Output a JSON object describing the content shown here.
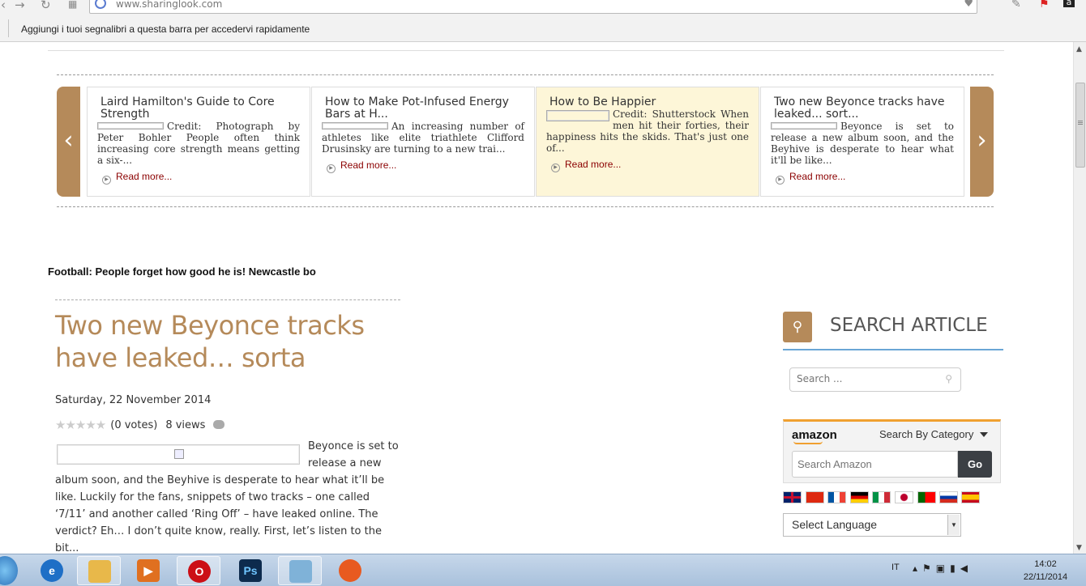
{
  "browser": {
    "url": "www.sharinglook.com",
    "bookmarks_hint": "Aggiungi i tuoi segnalibri a questa barra per accedervi rapidamente"
  },
  "carousel": {
    "prev_icon": "chevron-left-icon",
    "next_icon": "chevron-right-icon",
    "cards": [
      {
        "title": "Laird Hamilton's Guide to Core Strength",
        "excerpt": "Credit: Photograph by Peter Bohler People often think increasing core strength means getting a six-...",
        "read_more": "Read more..."
      },
      {
        "title": "How to Make Pot-Infused Energy Bars at H...",
        "excerpt": "An increasing number of athletes like elite triathlete Clifford Drusinsky are turning to a new trai...",
        "read_more": "Read more..."
      },
      {
        "title": "How to Be Happier",
        "excerpt": "Credit: Shutterstock When men hit their forties, their happiness hits the skids. That's just one of...",
        "read_more": "Read more..."
      },
      {
        "title": "Two new Beyonce tracks have leaked... sort...",
        "excerpt": "Beyonce is set to release a new album soon, and the Beyhive is desperate to hear what it'll be like...",
        "read_more": "Read more..."
      }
    ]
  },
  "ticker": "Football: People forget how good he is! Newcastle bo",
  "article": {
    "title": "Two new Beyonce tracks have leaked… sorta",
    "date": "Saturday, 22 November 2014",
    "votes": "(0 votes)",
    "views": "8 views",
    "rating_stars": 0,
    "body": "Beyonce is set to release a new album soon, and the Beyhive is desperate to hear what it’ll be like. Luckily for the fans, snippets of two tracks – one called ‘7/11’ and another called ‘Ring Off’ – have leaked online. The verdict? Eh… I don’t quite know, really. First, let’s listen to the bit..."
  },
  "sidebar": {
    "search_heading": "SEARCH ARTICLE",
    "search_placeholder": "Search ...",
    "amazon_logo": "amazon",
    "amazon_category": "Search By Category",
    "amazon_placeholder": "Search Amazon",
    "amazon_go": "Go",
    "flags": [
      "English",
      "Chinese",
      "French",
      "German",
      "Italian",
      "Japanese",
      "Portuguese",
      "Russian",
      "Spanish"
    ],
    "language_select": "Select Language"
  },
  "taskbar": {
    "apps": [
      "Internet Explorer",
      "Windows Explorer",
      "Media Player",
      "Opera",
      "Photoshop",
      "Notepad",
      "Firewall"
    ],
    "language": "IT",
    "time": "14:02",
    "date": "22/11/2014"
  },
  "colors": {
    "accent": "#b58a5a",
    "read_more": "#8b0000",
    "highlight_card": "#fdf6d8",
    "amazon_orange": "#f0a030"
  }
}
